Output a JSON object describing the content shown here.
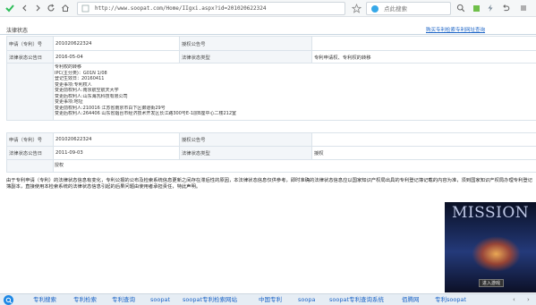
{
  "browser": {
    "url": "http://www.soopat.com/Home/IIgxi.aspx?id=201020622324",
    "search_placeholder": "点此搜索"
  },
  "page": {
    "title": "法律状态",
    "top_link": "购买专利检索专利网址查询"
  },
  "record1": {
    "app_no_label": "申请（专利）号",
    "app_no": "201020622324",
    "pub_no_label": "授权公告号",
    "pub_no": "",
    "date_label": "法律状态公告日",
    "date": "2016-05-04",
    "type_label": "法律状态类型",
    "type": "专利申请权、专利权的转移",
    "detail_lines": [
      "专利权的转移",
      "IPC(主分类)：G01N 1/08",
      "登记生效日：20160411",
      "变更事项:专利权人",
      "变更前权利人:南京航空航天大学",
      "变更后权利人:山东海瓦科技有限公司",
      "变更事项:地址",
      "变更前权利人:210016 江苏省南京市白下区御道街29号",
      "变更后权利人:264406 山东省烟台市经济技术开发区长江路300号E-1层B座中心二楼212室"
    ]
  },
  "record2": {
    "app_no_label": "申请（专利）号",
    "app_no": "201020622324",
    "pub_no_label": "授权公告号",
    "pub_no": "",
    "date_label": "法律状态公告日",
    "date": "2011-09-03",
    "type_label": "法律状态类型",
    "type": "授权",
    "detail": "授权"
  },
  "disclaimer": "由于专利申请（专利）的法律状态信息有变化，专利公报的公布及检索系统信息更新之间存在滞后性的原因，本法律状态信息仅供参考，即时准确的法律状态信息应以国家知识产权局出具的专利登记簿记载的内容为准，须到国家知识产权局办理专利登记簿副本，直接使用本检索系统的法律状态信息引起的后果问题由使用者承担责任，特此声明。",
  "video": {
    "title": "MISSION",
    "button": "进入游戏"
  },
  "bottom_nav": [
    "专利搜索",
    "专利检索",
    "专利查询",
    "soopat",
    "soopat专利检索网站",
    "中国专利",
    "soopa",
    "soopat专利查询系统",
    "佰腾网",
    "专利soopat"
  ],
  "colors": {
    "link": "#1a63c6",
    "label_bg": "#f3f6f9",
    "border": "#dbe3ea",
    "bottombar_bg": "#e6edf4"
  },
  "icons": {
    "back": "back-arrow-icon",
    "forward": "forward-arrow-icon",
    "refresh": "refresh-icon",
    "home": "home-icon",
    "favorite": "star-icon",
    "search": "search-icon",
    "menu": "menu-icon"
  }
}
